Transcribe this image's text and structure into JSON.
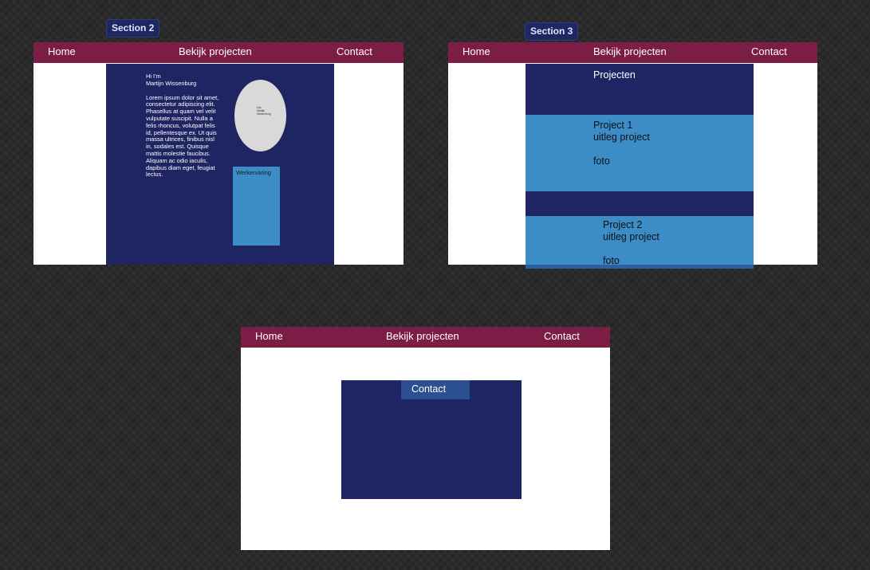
{
  "nav": {
    "home": "Home",
    "projects": "Bekijk projecten",
    "contact": "Contact"
  },
  "section2": {
    "label": "Section 2",
    "greeting": "Hi I'm",
    "name": "Martijn Wissenburg",
    "bio_lines": [
      "Lorem ipsum dolor sit amet,",
      "consectetur adipiscing elit.",
      "Phasellus at quam vel velit",
      "vulputate suscipit. Nulla a",
      "felis rhoncus, volutpat felis",
      "id, pellentesque ex. Ut quis",
      "massa ultrices, finibus nisl",
      "in, sodales est. Quisque",
      "mattis molestie faucibus.",
      "Aliquam ac odio iaculis,",
      "dapibus diam eget, feugiat",
      "lectus."
    ],
    "photo_lines": [
      "foto",
      "Martijn",
      "Wissenburg"
    ],
    "experience": "Werkervaring"
  },
  "section3": {
    "label": "Section 3",
    "title": "Projecten",
    "projects": [
      {
        "title": "Project 1",
        "desc": "uitleg project",
        "photo": "foto"
      },
      {
        "title": "Project 2",
        "desc": "uitleg project",
        "photo": "foto"
      }
    ]
  },
  "contact_section": {
    "title": "Contact"
  },
  "colors": {
    "nav": "#7b1d45",
    "navy": "#1f2462",
    "light_blue": "#3c8cc7",
    "photo": "#d9d9d9",
    "contact_tab": "#2c4f91",
    "label_bg": "#1f2761"
  }
}
